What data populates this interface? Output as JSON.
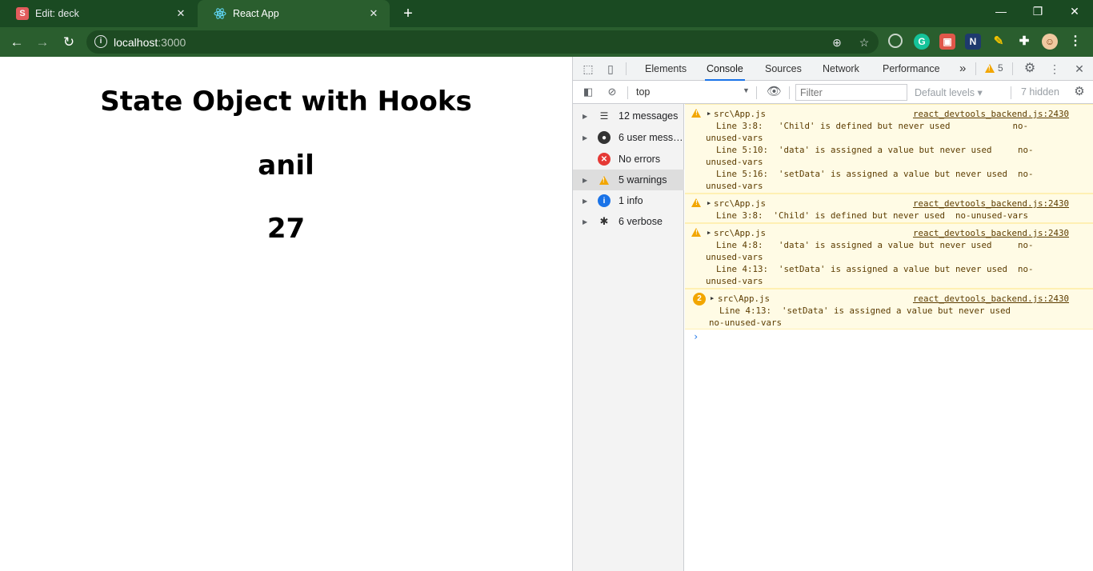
{
  "browser": {
    "tabs": [
      {
        "title": "Edit: deck",
        "favicon": "S",
        "close": "✕"
      },
      {
        "title": "React App",
        "favicon": "react-icon",
        "close": "✕"
      }
    ],
    "new_tab": "+",
    "window_controls": {
      "minimize": "—",
      "restore": "❐",
      "close": "✕"
    },
    "url_host": "localhost",
    "url_port": ":3000"
  },
  "page": {
    "title": "State Object with Hooks",
    "name": "anil",
    "age": "27"
  },
  "devtools": {
    "tabs": [
      "Elements",
      "Console",
      "Sources",
      "Network",
      "Performance"
    ],
    "active_tab": "Console",
    "more_tabs": "»",
    "warning_count": "5",
    "context": "top",
    "filter_placeholder": "Filter",
    "levels": "Default levels",
    "hidden": "7 hidden",
    "sidebar": [
      {
        "label": "12 messages",
        "icon": "list-icon"
      },
      {
        "label": "6 user mess…",
        "icon": "user-icon"
      },
      {
        "label": "No errors",
        "icon": "error-icon"
      },
      {
        "label": "5 warnings",
        "icon": "warning-icon"
      },
      {
        "label": "1 info",
        "icon": "info-icon"
      },
      {
        "label": "6 verbose",
        "icon": "bug-icon"
      }
    ],
    "messages": [
      {
        "src": "src\\App.js",
        "link": "react_devtools_backend.js:2430",
        "lines": [
          "  Line 3:8:   'Child' is defined but never used            no-",
          "unused-vars",
          "  Line 5:10:  'data' is assigned a value but never used     no-",
          "unused-vars",
          "  Line 5:16:  'setData' is assigned a value but never used  no-",
          "unused-vars"
        ]
      },
      {
        "src": "src\\App.js",
        "link": "react_devtools_backend.js:2430",
        "lines": [
          "  Line 3:8:  'Child' is defined but never used  no-unused-vars"
        ]
      },
      {
        "src": "src\\App.js",
        "link": "react_devtools_backend.js:2430",
        "lines": [
          "  Line 4:8:   'data' is assigned a value but never used     no-",
          "unused-vars",
          "  Line 4:13:  'setData' is assigned a value but never used  no-",
          "unused-vars"
        ]
      },
      {
        "src": "src\\App.js",
        "link": "react_devtools_backend.js:2430",
        "repeat": "2",
        "lines": [
          "  Line 4:13:  'setData' is assigned a value but never used",
          "no-unused-vars"
        ]
      }
    ],
    "prompt": "›"
  }
}
